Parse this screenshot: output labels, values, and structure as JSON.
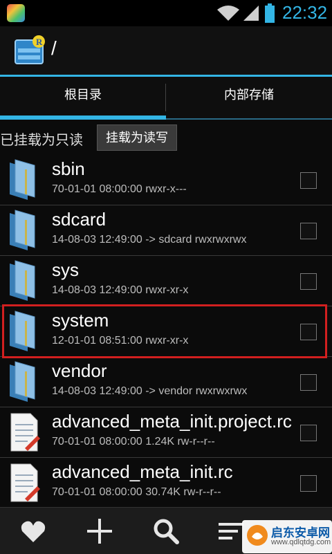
{
  "status": {
    "time": "22:32"
  },
  "title": {
    "path": "/"
  },
  "tabs": [
    {
      "label": "根目录"
    },
    {
      "label": "内部存储"
    }
  ],
  "mount": {
    "status": "已挂载为只读",
    "button": "挂载为读写"
  },
  "files": [
    {
      "name": "sbin",
      "meta": "70-01-01 08:00:00   rwxr-x---",
      "type": "folder"
    },
    {
      "name": "sdcard",
      "meta": "14-08-03 12:49:00  -> sdcard  rwxrwxrwx",
      "type": "folder"
    },
    {
      "name": "sys",
      "meta": "14-08-03 12:49:00   rwxr-xr-x",
      "type": "folder"
    },
    {
      "name": "system",
      "meta": "12-01-01 08:51:00   rwxr-xr-x",
      "type": "folder"
    },
    {
      "name": "vendor",
      "meta": "14-08-03 12:49:00  -> vendor  rwxrwxrwx",
      "type": "folder"
    },
    {
      "name": "advanced_meta_init.project.rc",
      "meta": "70-01-01 08:00:00  1.24K  rw-r--r--",
      "type": "file"
    },
    {
      "name": "advanced_meta_init.rc",
      "meta": "70-01-01 08:00:00  30.74K  rw-r--r--",
      "type": "file"
    }
  ],
  "bottom_bar": {
    "icons": [
      "heart-icon",
      "plus-icon",
      "search-icon",
      "sort-icon",
      "more-icon"
    ]
  },
  "watermark": {
    "title": "启东安卓网",
    "url": "www.qdlqtdg.com"
  },
  "colors": {
    "accent": "#33b5e5",
    "highlight": "#d21f1f"
  }
}
